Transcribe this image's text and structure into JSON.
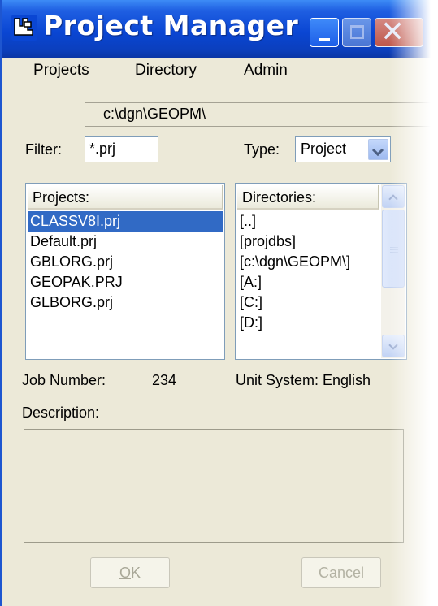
{
  "window": {
    "title": "Project Manager"
  },
  "menu": {
    "items": [
      {
        "label": "Projects",
        "mnemonic": "P",
        "rest": "rojects"
      },
      {
        "label": "Directory",
        "mnemonic": "D",
        "rest": "irectory"
      },
      {
        "label": "Admin",
        "mnemonic": "A",
        "rest": "dmin"
      }
    ]
  },
  "path": {
    "value": "c:\\dgn\\GEOPM\\"
  },
  "filter": {
    "label": "Filter:",
    "value": "*.prj"
  },
  "type": {
    "label": "Type:",
    "selected": "Project"
  },
  "projects_list": {
    "header": "Projects:",
    "items": [
      "CLASSV8I.prj",
      "Default.prj",
      "GBLORG.prj",
      "GEOPAK.PRJ",
      "GLBORG.prj"
    ],
    "selected_index": 0
  },
  "directories_list": {
    "header": "Directories:",
    "items": [
      "[..]",
      "[projdbs]",
      "[c:\\dgn\\GEOPM\\]",
      "[A:]",
      "[C:]",
      "[D:]"
    ]
  },
  "info": {
    "job_number_label": "Job Number:",
    "job_number_value": "234",
    "unit_system_label": "Unit System: English",
    "description_label": "Description:",
    "description_value": ""
  },
  "buttons": {
    "ok": {
      "label": "OK",
      "mnemonic": "O",
      "rest": "K"
    },
    "cancel": {
      "label": "Cancel"
    }
  },
  "colors": {
    "titlebar": "#0a46d3",
    "selection": "#316ac5",
    "dialog_bg": "#ece9d8"
  }
}
